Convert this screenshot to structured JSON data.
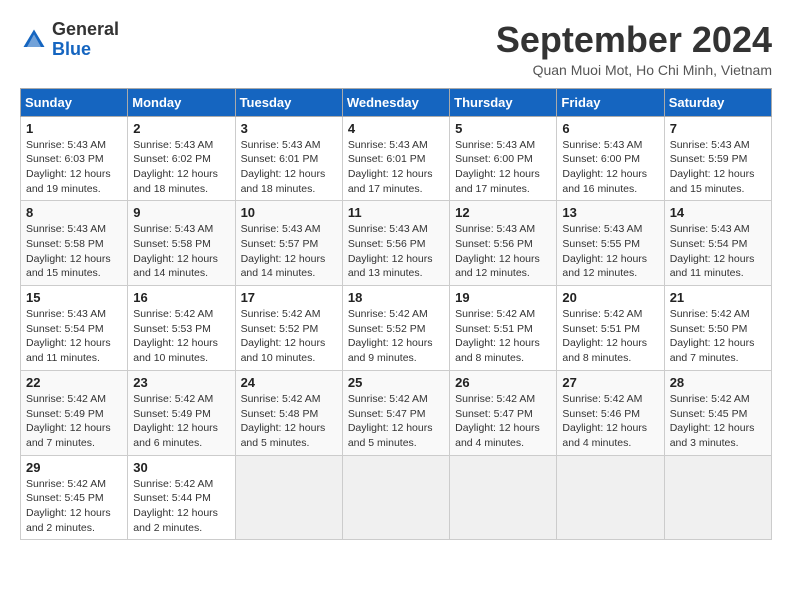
{
  "header": {
    "logo_general": "General",
    "logo_blue": "Blue",
    "month_title": "September 2024",
    "location": "Quan Muoi Mot, Ho Chi Minh, Vietnam"
  },
  "calendar": {
    "days_of_week": [
      "Sunday",
      "Monday",
      "Tuesday",
      "Wednesday",
      "Thursday",
      "Friday",
      "Saturday"
    ],
    "weeks": [
      [
        null,
        {
          "day": "2",
          "sunrise": "5:43 AM",
          "sunset": "6:02 PM",
          "daylight": "12 hours and 18 minutes."
        },
        {
          "day": "3",
          "sunrise": "5:43 AM",
          "sunset": "6:01 PM",
          "daylight": "12 hours and 18 minutes."
        },
        {
          "day": "4",
          "sunrise": "5:43 AM",
          "sunset": "6:01 PM",
          "daylight": "12 hours and 17 minutes."
        },
        {
          "day": "5",
          "sunrise": "5:43 AM",
          "sunset": "6:00 PM",
          "daylight": "12 hours and 17 minutes."
        },
        {
          "day": "6",
          "sunrise": "5:43 AM",
          "sunset": "6:00 PM",
          "daylight": "12 hours and 16 minutes."
        },
        {
          "day": "7",
          "sunrise": "5:43 AM",
          "sunset": "5:59 PM",
          "daylight": "12 hours and 15 minutes."
        }
      ],
      [
        {
          "day": "1",
          "sunrise": "5:43 AM",
          "sunset": "6:03 PM",
          "daylight": "12 hours and 19 minutes."
        },
        null,
        null,
        null,
        null,
        null,
        null
      ],
      [
        {
          "day": "8",
          "sunrise": "5:43 AM",
          "sunset": "5:58 PM",
          "daylight": "12 hours and 15 minutes."
        },
        {
          "day": "9",
          "sunrise": "5:43 AM",
          "sunset": "5:58 PM",
          "daylight": "12 hours and 14 minutes."
        },
        {
          "day": "10",
          "sunrise": "5:43 AM",
          "sunset": "5:57 PM",
          "daylight": "12 hours and 14 minutes."
        },
        {
          "day": "11",
          "sunrise": "5:43 AM",
          "sunset": "5:56 PM",
          "daylight": "12 hours and 13 minutes."
        },
        {
          "day": "12",
          "sunrise": "5:43 AM",
          "sunset": "5:56 PM",
          "daylight": "12 hours and 12 minutes."
        },
        {
          "day": "13",
          "sunrise": "5:43 AM",
          "sunset": "5:55 PM",
          "daylight": "12 hours and 12 minutes."
        },
        {
          "day": "14",
          "sunrise": "5:43 AM",
          "sunset": "5:54 PM",
          "daylight": "12 hours and 11 minutes."
        }
      ],
      [
        {
          "day": "15",
          "sunrise": "5:43 AM",
          "sunset": "5:54 PM",
          "daylight": "12 hours and 11 minutes."
        },
        {
          "day": "16",
          "sunrise": "5:42 AM",
          "sunset": "5:53 PM",
          "daylight": "12 hours and 10 minutes."
        },
        {
          "day": "17",
          "sunrise": "5:42 AM",
          "sunset": "5:52 PM",
          "daylight": "12 hours and 10 minutes."
        },
        {
          "day": "18",
          "sunrise": "5:42 AM",
          "sunset": "5:52 PM",
          "daylight": "12 hours and 9 minutes."
        },
        {
          "day": "19",
          "sunrise": "5:42 AM",
          "sunset": "5:51 PM",
          "daylight": "12 hours and 8 minutes."
        },
        {
          "day": "20",
          "sunrise": "5:42 AM",
          "sunset": "5:51 PM",
          "daylight": "12 hours and 8 minutes."
        },
        {
          "day": "21",
          "sunrise": "5:42 AM",
          "sunset": "5:50 PM",
          "daylight": "12 hours and 7 minutes."
        }
      ],
      [
        {
          "day": "22",
          "sunrise": "5:42 AM",
          "sunset": "5:49 PM",
          "daylight": "12 hours and 7 minutes."
        },
        {
          "day": "23",
          "sunrise": "5:42 AM",
          "sunset": "5:49 PM",
          "daylight": "12 hours and 6 minutes."
        },
        {
          "day": "24",
          "sunrise": "5:42 AM",
          "sunset": "5:48 PM",
          "daylight": "12 hours and 5 minutes."
        },
        {
          "day": "25",
          "sunrise": "5:42 AM",
          "sunset": "5:47 PM",
          "daylight": "12 hours and 5 minutes."
        },
        {
          "day": "26",
          "sunrise": "5:42 AM",
          "sunset": "5:47 PM",
          "daylight": "12 hours and 4 minutes."
        },
        {
          "day": "27",
          "sunrise": "5:42 AM",
          "sunset": "5:46 PM",
          "daylight": "12 hours and 4 minutes."
        },
        {
          "day": "28",
          "sunrise": "5:42 AM",
          "sunset": "5:45 PM",
          "daylight": "12 hours and 3 minutes."
        }
      ],
      [
        {
          "day": "29",
          "sunrise": "5:42 AM",
          "sunset": "5:45 PM",
          "daylight": "12 hours and 2 minutes."
        },
        {
          "day": "30",
          "sunrise": "5:42 AM",
          "sunset": "5:44 PM",
          "daylight": "12 hours and 2 minutes."
        },
        null,
        null,
        null,
        null,
        null
      ]
    ]
  }
}
